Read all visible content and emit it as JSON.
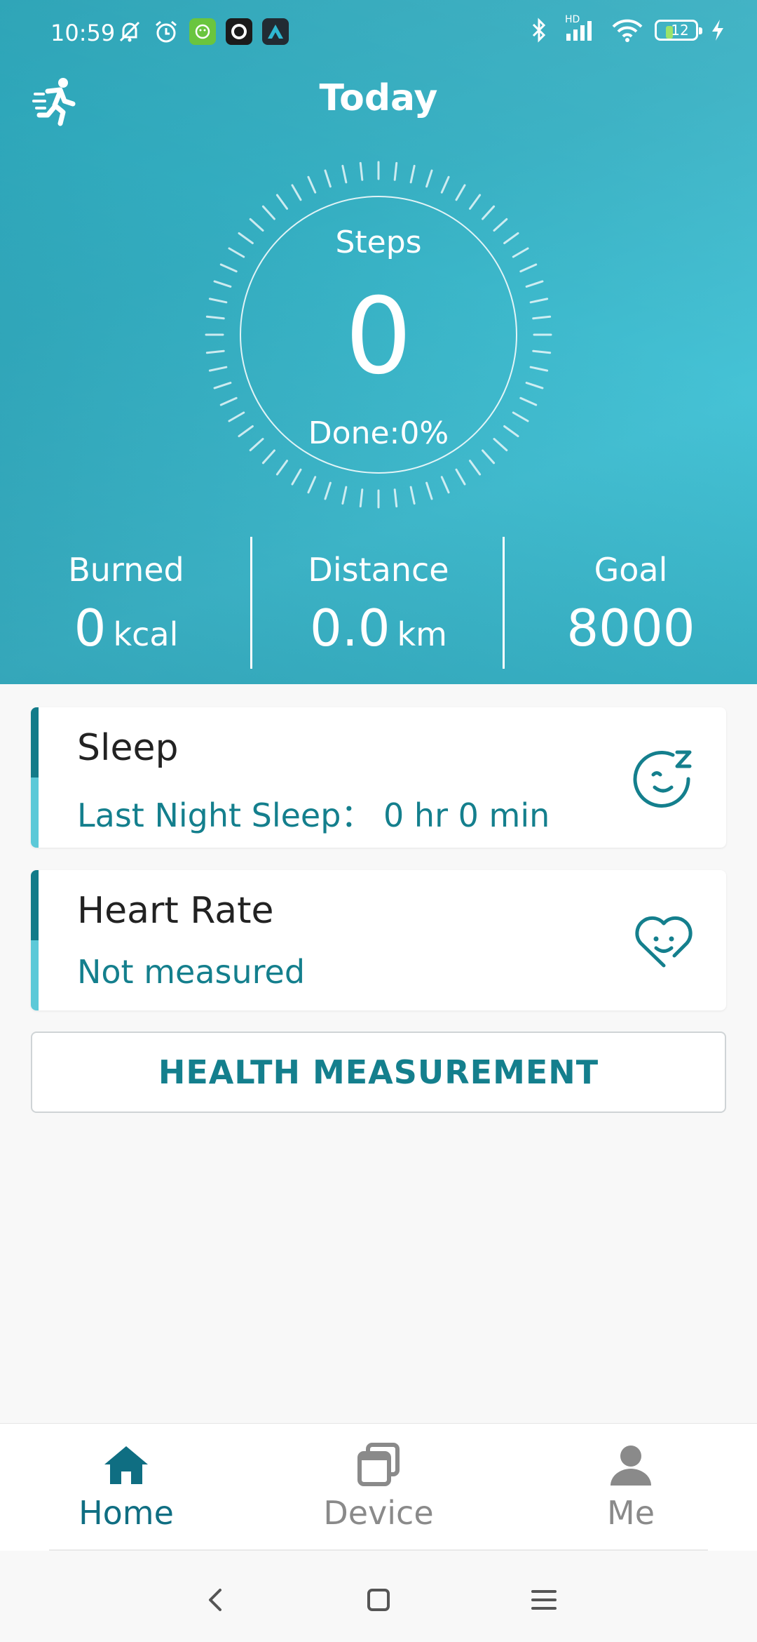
{
  "status_bar": {
    "time": "10:59",
    "left_icons": [
      "muted-bell-icon",
      "alarm-icon",
      "app-notification-icon",
      "app-notification-icon",
      "app-notification-icon"
    ],
    "right_icons": [
      "bluetooth-icon",
      "signal-icon",
      "wifi-icon",
      "battery-icon",
      "charging-icon"
    ],
    "network_badge": "HD",
    "battery_level": "12",
    "battery_fill_color": "#9be36a"
  },
  "header": {
    "title": "Today",
    "left_icon": "running-person-icon"
  },
  "steps_ring": {
    "label": "Steps",
    "value": "0",
    "done_text": "Done:0%",
    "progress_percent": 0
  },
  "stats": [
    {
      "label": "Burned",
      "value": "0",
      "unit": "kcal"
    },
    {
      "label": "Distance",
      "value": "0.0",
      "unit": "km"
    },
    {
      "label": "Goal",
      "value": "8000",
      "unit": ""
    }
  ],
  "cards": {
    "sleep": {
      "title": "Sleep",
      "subtitle": "Last Night Sleep： 0 hr 0 min",
      "icon": "sleep-face-icon"
    },
    "heart_rate": {
      "title": "Heart Rate",
      "subtitle": "Not measured",
      "icon": "heart-face-icon"
    }
  },
  "measure_button": {
    "label": "HEALTH MEASUREMENT"
  },
  "bottom_nav": {
    "items": [
      {
        "label": "Home",
        "icon": "home-icon",
        "active": true
      },
      {
        "label": "Device",
        "icon": "device-icon",
        "active": false
      },
      {
        "label": "Me",
        "icon": "person-icon",
        "active": false
      }
    ],
    "active_color": "#0f6e82",
    "inactive_color": "#8a8a8a"
  },
  "system_nav": {
    "buttons": [
      "back-icon",
      "home-square-icon",
      "menu-icon"
    ]
  },
  "colors": {
    "accent": "#147f8d",
    "hero_start": "#2ba3b6",
    "hero_end": "#46c3d6"
  }
}
